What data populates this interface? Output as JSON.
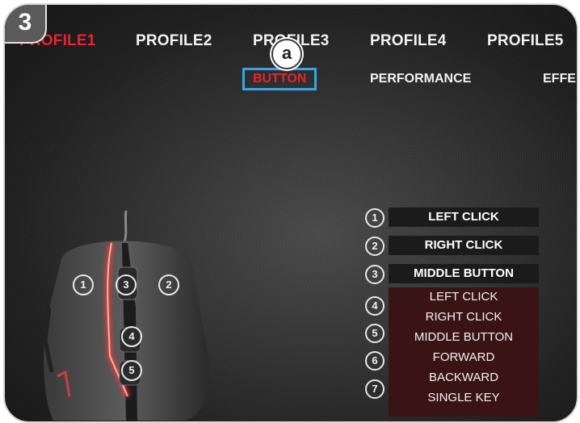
{
  "step_label": "3",
  "callout_label": "a",
  "profiles": [
    "PROFILE1",
    "PROFILE2",
    "PROFILE3",
    "PROFILE4",
    "PROFILE5"
  ],
  "subtabs": [
    "BUTTON",
    "PERFORMANCE",
    "EFFE"
  ],
  "mouse_markers": [
    "1",
    "3",
    "2",
    "4",
    "5"
  ],
  "button_rows": [
    {
      "num": "1",
      "label": "LEFT CLICK"
    },
    {
      "num": "2",
      "label": "RIGHT CLICK"
    },
    {
      "num": "3",
      "label": "MIDDLE BUTTON"
    }
  ],
  "dropdown": {
    "markers": [
      "4",
      "5",
      "6",
      "7"
    ],
    "options": [
      "LEFT CLICK",
      "RIGHT CLICK",
      "MIDDLE BUTTON",
      "FORWARD",
      "BACKWARD",
      "SINGLE KEY"
    ]
  },
  "colors": {
    "accent_red": "#e3262f",
    "highlight_blue": "#3aa6dd",
    "dropdown_bg": "#3a1414"
  }
}
